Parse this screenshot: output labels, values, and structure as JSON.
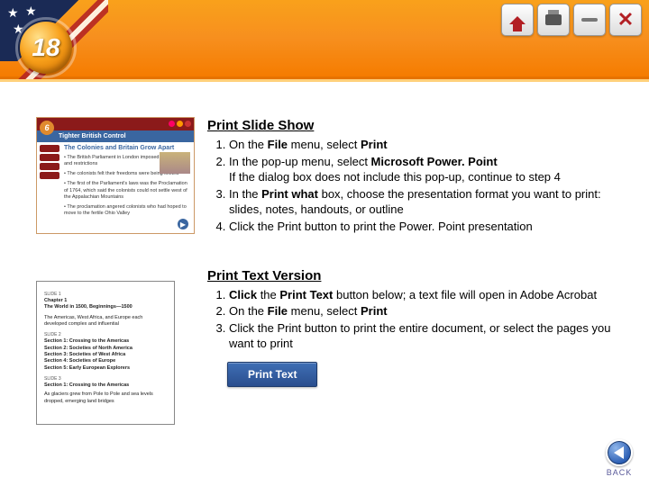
{
  "chapter_number": "18",
  "nav": {
    "home": "home-icon",
    "print": "printer-icon",
    "minimize": "minimize-icon",
    "close": "close-icon"
  },
  "thumb1": {
    "badge": "6",
    "title": "Tighter British Control",
    "subtitle": "The Colonies and Britain Grow Apart",
    "bullet1": "• The British Parliament in London imposed new laws and restrictions",
    "bullet2": "• The colonists felt their freedoms were being limited",
    "bullet3": "• The first of the Parliament's laws was the Proclamation of 1764, which said the colonists could not settle west of the Appalachian Mountains",
    "bullet4": "• The proclamation angered colonists who had hoped to move to the fertile Ohio Valley"
  },
  "section1": {
    "title": "Print Slide Show",
    "s1a": "On the ",
    "s1b": "File ",
    "s1c": "menu, select ",
    "s1d": "Print",
    "s2a": "In the pop-up menu, select ",
    "s2b": "Microsoft Power. Point",
    "s2c": "If the dialog box does not include this pop-up, continue to step 4",
    "s3a": "In the ",
    "s3b": "Print what ",
    "s3c": "box, choose the presentation format you want to print: slides, notes, handouts, or outline",
    "s4": "Click the Print button to print the Power. Point presentation"
  },
  "thumb2": {
    "sl1": "SLIDE 1",
    "ch": "Chapter 1",
    "chsub": "The World in 1500, Beginnings—1500",
    "line1": "The Americas, West Africa, and Europe each developed complex and influential",
    "sl2": "SLIDE 2",
    "sec1": "Section 1: Crossing to the Americas",
    "sec2": "Section 2: Societies of North America",
    "sec3": "Section 3: Societies of West Africa",
    "sec4": "Section 4: Societies of Europe",
    "sec5": "Section 5: Early European Explorers",
    "sl3": "SLIDE 3",
    "sec1b": "Section 1: Crossing to the Americas",
    "tail": "As glaciers grew from Pole to Pole and sea levels dropped, emerging land bridges"
  },
  "section2": {
    "title": "Print Text Version",
    "s1a": "Click ",
    "s1b": "the ",
    "s1c": "Print Text ",
    "s1d": "button below; a text file will open in  Adobe Acrobat",
    "s2a": "On the ",
    "s2b": "File ",
    "s2c": "menu, select ",
    "s2d": "Print",
    "s3": "Click the Print button to print the entire document, or select the pages you want to print",
    "button": "Print Text"
  },
  "back_label": "BACK"
}
